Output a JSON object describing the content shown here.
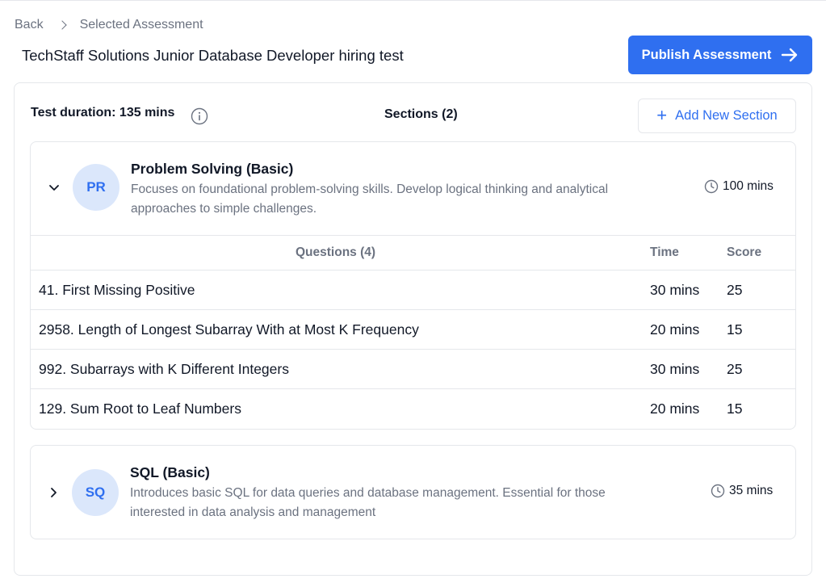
{
  "breadcrumb": {
    "back": "Back",
    "current": "Selected Assessment"
  },
  "title": "TechStaff Solutions Junior Database Developer hiring test",
  "publish_label": "Publish Assessment",
  "toolbar": {
    "duration": "Test duration: 135 mins",
    "sections_count": "Sections (2)",
    "add_section_label": "Add New Section"
  },
  "sections": [
    {
      "initials": "PR",
      "name": "Problem Solving (Basic)",
      "description_line1": "Focuses on foundational problem-solving skills. Develop logical thinking and analytical",
      "description_line2": "approaches to simple challenges.",
      "time": "100 mins",
      "expanded": true,
      "table": {
        "header_questions": "Questions (4)",
        "header_time": "Time",
        "header_score": "Score",
        "rows": [
          {
            "question": "41. First Missing Positive",
            "time": "30 mins",
            "score": "25"
          },
          {
            "question": "2958. Length of Longest Subarray With at Most K Frequency",
            "time": "20 mins",
            "score": "15"
          },
          {
            "question": "992. Subarrays with K Different Integers",
            "time": "30 mins",
            "score": "25"
          },
          {
            "question": "129. Sum Root to Leaf Numbers",
            "time": "20 mins",
            "score": "15"
          }
        ]
      }
    },
    {
      "initials": "SQ",
      "name": "SQL (Basic)",
      "description_line1": "Introduces basic SQL for data queries and database management. Essential for those",
      "description_line2": "interested in data analysis and management",
      "time": "35 mins",
      "expanded": false
    }
  ],
  "colors": {
    "accent": "#2f6ff0",
    "avatar_bg": "#dbe7fb",
    "muted": "#6b7280",
    "border": "#e5e7eb"
  },
  "icons": {
    "breadcrumb_separator": "chevron-right-icon",
    "publish": "arrow-right-icon",
    "info": "info-icon",
    "add": "plus-icon",
    "expanded": "chevron-down-icon",
    "collapsed": "chevron-right-icon",
    "time": "clock-icon"
  }
}
